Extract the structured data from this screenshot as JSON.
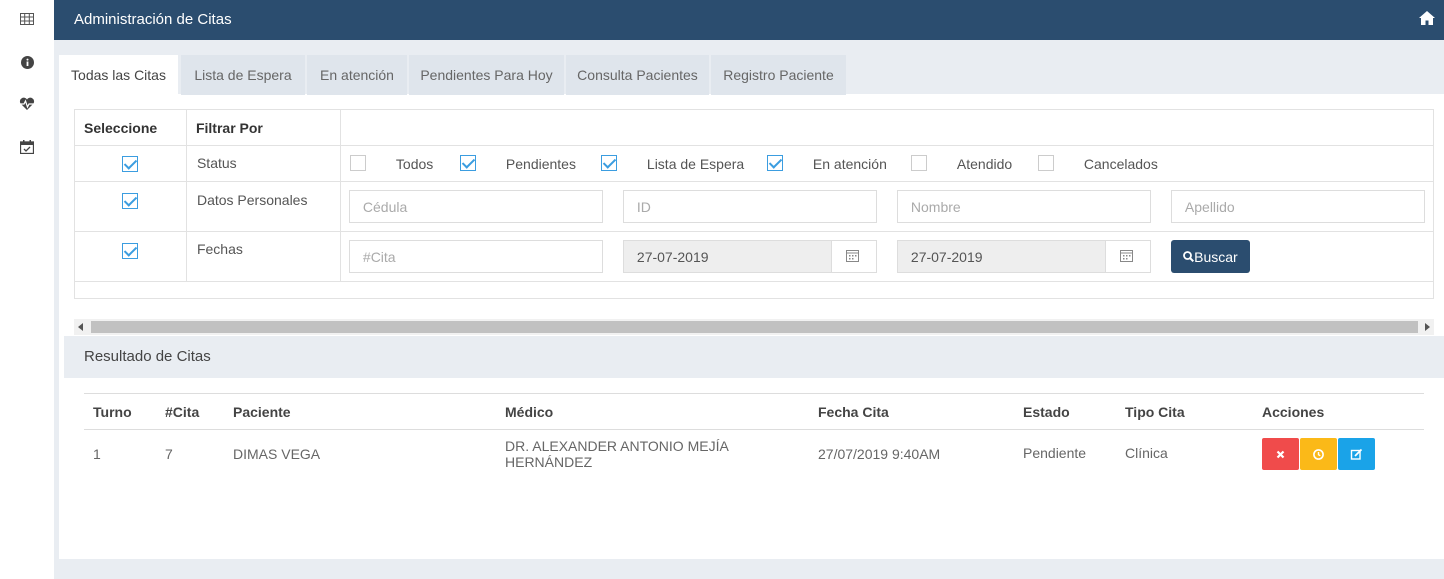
{
  "sidebar": {
    "icons": [
      "table-icon",
      "info-icon",
      "heartbeat-icon",
      "calendar-check-icon"
    ]
  },
  "header": {
    "title": "Administración de Citas",
    "home_icon": "home-icon",
    "color": "#2b4d6f"
  },
  "tabs": [
    {
      "label": "Todas las Citas",
      "active": true
    },
    {
      "label": "Lista de Espera",
      "active": false
    },
    {
      "label": "En atención",
      "active": false
    },
    {
      "label": "Pendientes Para Hoy",
      "active": false
    },
    {
      "label": "Consulta Pacientes",
      "active": false
    },
    {
      "label": "Registro Paciente",
      "active": false
    }
  ],
  "filter": {
    "col_select": "Seleccione",
    "col_filter": "Filtrar Por",
    "rows": [
      {
        "label": "Status",
        "checked": true
      },
      {
        "label": "Datos Personales",
        "checked": true
      },
      {
        "label": "Fechas",
        "checked": true
      }
    ],
    "status_options": [
      {
        "label": "Todos",
        "checked": false
      },
      {
        "label": "Pendientes",
        "checked": true
      },
      {
        "label": "Lista de Espera",
        "checked": true
      },
      {
        "label": "En atención",
        "checked": true
      },
      {
        "label": "Atendido",
        "checked": false
      },
      {
        "label": "Cancelados",
        "checked": false
      }
    ],
    "placeholders": {
      "cedula": "Cédula",
      "id": "ID",
      "nombre": "Nombre",
      "apellido": "Apellido",
      "cita": "#Cita"
    },
    "date_from": "27-07-2019",
    "date_to": "27-07-2019",
    "search_button": "Buscar"
  },
  "results": {
    "title": "Resultado de Citas",
    "columns": [
      "Turno",
      "#Cita",
      "Paciente",
      "Médico",
      "Fecha Cita",
      "Estado",
      "Tipo Cita",
      "Acciones"
    ],
    "rows": [
      {
        "turno": "1",
        "cita": "7",
        "paciente": "DIMAS VEGA",
        "medico": "DR. ALEXANDER ANTONIO MEJÍA HERNÁNDEZ",
        "fecha": "27/07/2019 9:40AM",
        "estado": "Pendiente",
        "tipo": "Clínica",
        "actions": [
          "cancel-icon",
          "clock-icon",
          "edit-icon"
        ]
      }
    ]
  },
  "colors": {
    "accent": "#2b4d6f",
    "check": "#3b9de0",
    "danger": "#f04b4b",
    "warning": "#fbb918",
    "info": "#1aa3e8"
  }
}
